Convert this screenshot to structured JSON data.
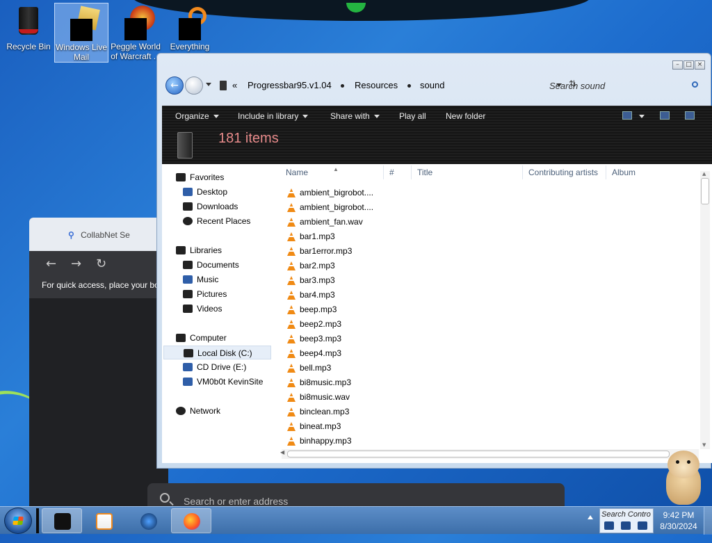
{
  "desktop": {
    "icons": [
      {
        "label": "Recycle Bin"
      },
      {
        "label": "Windows Live Mail"
      },
      {
        "label": "Peggle World of Warcraft ..."
      },
      {
        "label": "Everything"
      }
    ]
  },
  "background_browser": {
    "tab_title": "CollabNet Se",
    "bookmarks_hint": "For quick access, place your bo",
    "address_placeholder": "Search or enter address"
  },
  "explorer": {
    "breadcrumb": [
      "Progressbar95.v1.04",
      "Resources",
      "sound"
    ],
    "breadcrumb_overflow": "«",
    "search_placeholder": "Search sound",
    "toolbar": {
      "organize": "Organize",
      "include_in_library": "Include in library",
      "share_with": "Share with",
      "play_all": "Play all",
      "new_folder": "New folder"
    },
    "items_count": "181 items",
    "nav_pane": {
      "favorites": "Favorites",
      "desktop": "Desktop",
      "downloads": "Downloads",
      "recent_places": "Recent Places",
      "libraries": "Libraries",
      "documents": "Documents",
      "music": "Music",
      "pictures": "Pictures",
      "videos": "Videos",
      "computer": "Computer",
      "local_disk": "Local Disk (C:)",
      "cd_drive": "CD Drive (E:)",
      "vm_site": "VM0b0t KevinSite",
      "network": "Network"
    },
    "columns": {
      "name": "Name",
      "number": "#",
      "title": "Title",
      "contributing_artists": "Contributing artists",
      "album": "Album"
    },
    "files": [
      "ambient_bigrobot....",
      "ambient_bigrobot....",
      "ambient_fan.wav",
      "bar1.mp3",
      "bar1error.mp3",
      "bar2.mp3",
      "bar3.mp3",
      "bar4.mp3",
      "beep.mp3",
      "beep2.mp3",
      "beep3.mp3",
      "beep4.mp3",
      "bell.mp3",
      "bi8music.mp3",
      "bi8music.wav",
      "binclean.mp3",
      "bineat.mp3",
      "binhappy.mp3"
    ]
  },
  "taskbar": {
    "tray_search": "Search Contro",
    "time": "9:42 PM",
    "date": "8/30/2024"
  }
}
